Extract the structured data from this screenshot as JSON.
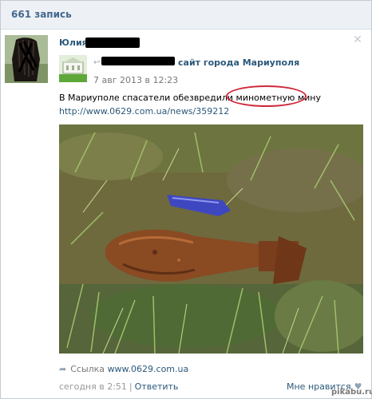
{
  "header": {
    "title": "661 запись"
  },
  "post": {
    "author_name": "Юлия",
    "group_name": "сайт города Мариуполя",
    "date": "7 авг 2013 в 12:23",
    "text_before": "В Мариуполе спасатели обезвредили ",
    "text_highlight": "минометную мину",
    "link": "http://www.0629.com.ua/news/359212",
    "attachment_label": "Ссылка",
    "attachment_url": "www.0629.com.ua",
    "footer_time": "сегодня в 2:51",
    "footer_separator": "|",
    "reply_label": "Ответить",
    "like_label": "Мне нравится"
  },
  "icons": {
    "close": "close-icon",
    "repost": "repost-icon",
    "attachment": "link-arrow-icon",
    "like": "heart-icon"
  },
  "watermark": "pikabu.ru",
  "colors": {
    "header_bg": "#edf1f5",
    "link": "#2b587a",
    "highlight_circle": "#d0283a"
  }
}
